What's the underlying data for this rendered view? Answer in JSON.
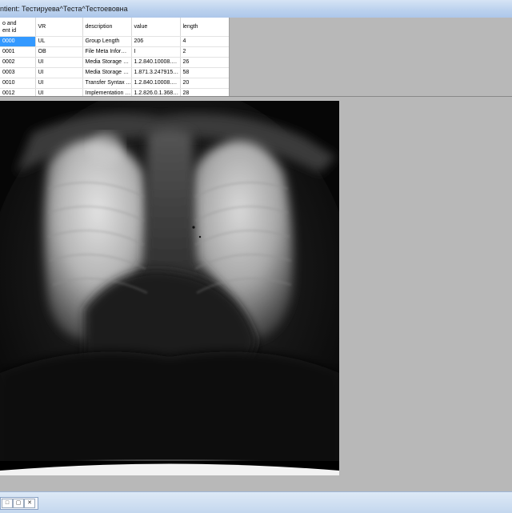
{
  "window": {
    "title": "ntient: Тестируева^Теста^Тестоевовна"
  },
  "tag_table": {
    "columns": [
      "o and\nent id",
      "VR",
      "description",
      "value",
      "length"
    ],
    "rows": [
      {
        "id": "0000",
        "vr": "UL",
        "description": "Group Length",
        "value": "206",
        "length": "4",
        "selected": true
      },
      {
        "id": "0001",
        "vr": "OB",
        "description": "File Meta Informa...",
        "value": "I",
        "length": "2",
        "selected": false
      },
      {
        "id": "0002",
        "vr": "UI",
        "description": "Media Storage S...",
        "value": "1.2.840.10008.5....",
        "length": "26",
        "selected": false
      },
      {
        "id": "0003",
        "vr": "UI",
        "description": "Media Storage S...",
        "value": "1.871.3.2479155...",
        "length": "58",
        "selected": false
      },
      {
        "id": "0010",
        "vr": "UI",
        "description": "Transfer Syntax ...",
        "value": "1.2.840.10008.1....",
        "length": "20",
        "selected": false
      },
      {
        "id": "0012",
        "vr": "UI",
        "description": "Implementation Cl...",
        "value": "1.2.826.0.1.3680...",
        "length": "28",
        "selected": false
      }
    ]
  },
  "image": {
    "subject": "chest x-ray"
  },
  "taskbar": {
    "restore_icon": "restore-icon",
    "maximize_icon": "maximize-icon",
    "close_icon": "close-icon"
  },
  "colors": {
    "selection": "#3399ff",
    "workspace": "#b8b8b8",
    "title_gradient_top": "#d6e4f5"
  }
}
